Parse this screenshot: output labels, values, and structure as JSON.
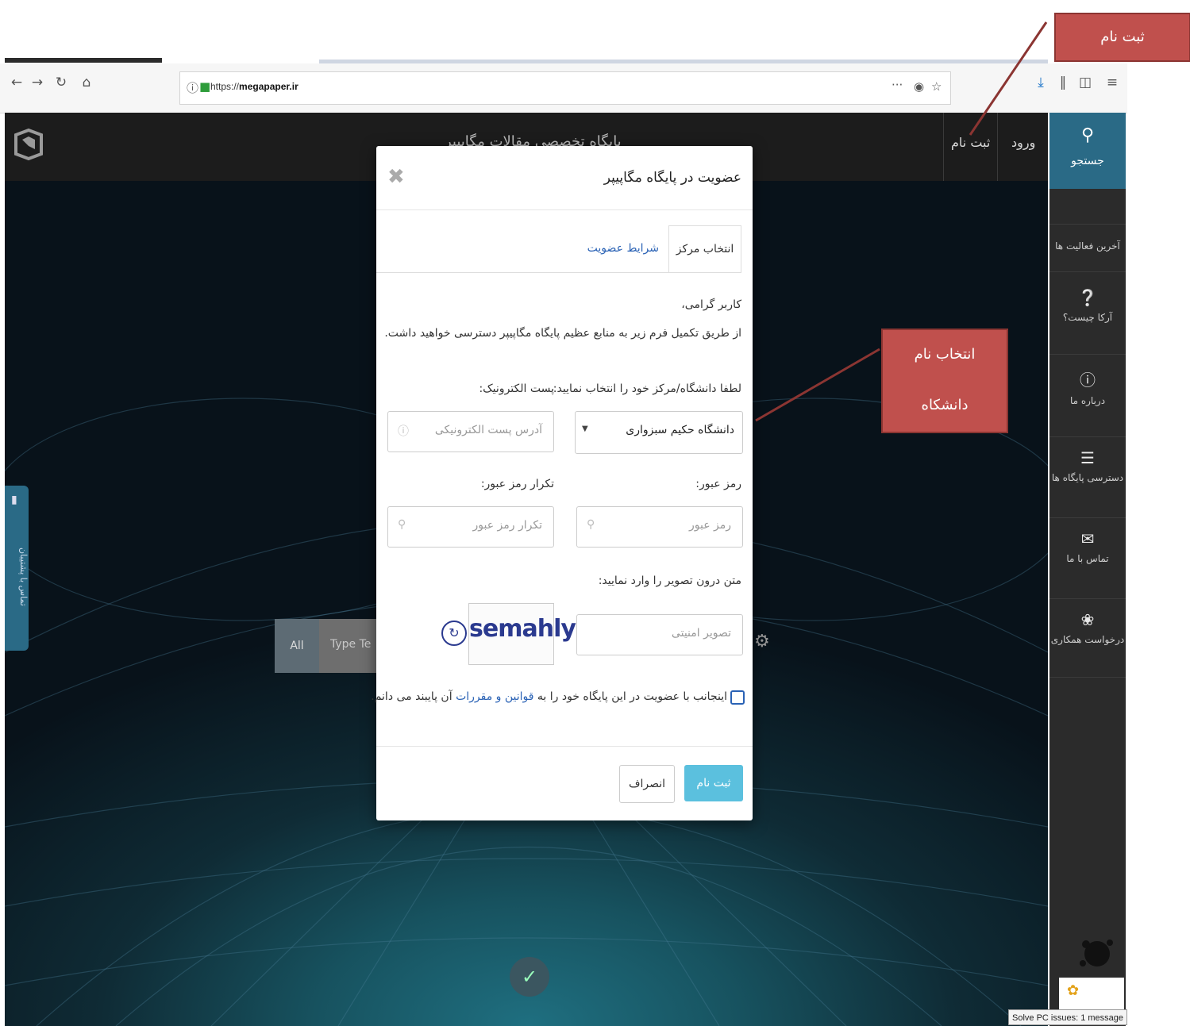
{
  "browser": {
    "url_prefix": "https://",
    "url_domain": "megapaper.ir",
    "url_actions": "···",
    "icons": [
      "back-icon",
      "forward-icon",
      "reload-icon",
      "home-icon",
      "info-icon",
      "lock-icon",
      "pocket-icon",
      "bookmark-star-icon",
      "download-icon",
      "library-icon",
      "sidebar-icon",
      "menu-icon"
    ]
  },
  "site": {
    "title": "پایگاه تخصصی مقالات مگاپیپر",
    "nav_login": "ورود",
    "nav_register": "ثبت نام"
  },
  "sidebar": {
    "search_label": "جستجو",
    "items": [
      {
        "label": "آخرین فعالیت ها",
        "icon": "none"
      },
      {
        "label": "آرکا چیست؟",
        "icon": "question-icon"
      },
      {
        "label": "درباره ما",
        "icon": "info-circle-icon"
      },
      {
        "label": "دسترسی پایگاه ها",
        "icon": "database-icon"
      },
      {
        "label": "تماس با ما",
        "icon": "envelope-icon"
      },
      {
        "label": "درخواست همکاری",
        "icon": "handshake-icon"
      }
    ]
  },
  "left_tab": {
    "label": "تماس با پشتیبان"
  },
  "bg_search": {
    "scope": "All",
    "placeholder": "Type Te"
  },
  "modal": {
    "title": "عضویت در پایگاه مگاپیپر",
    "tabs": {
      "center": "انتخاب مرکز",
      "terms": "شرایط عضویت"
    },
    "greeting": "کاربر گرامی،",
    "intro": "از طریق تکمیل فرم زیر به منابع عظیم پایگاه مگاپیپر دسترسی خواهید داشت.",
    "university": {
      "label": "لطفا دانشگاه/مرکز خود را انتخاب نمایید:",
      "value": "دانشگاه حکیم سبزواری"
    },
    "email": {
      "label": "پست الکترونیک:",
      "placeholder": "آدرس پست الکترونیکی"
    },
    "password": {
      "label": "رمز عبور:",
      "placeholder": "رمز عبور"
    },
    "password_repeat": {
      "label": "تکرار رمز عبور:",
      "placeholder": "تکرار رمز عبور"
    },
    "captcha": {
      "label": "متن درون تصویر را وارد نمایید:",
      "placeholder": "تصویر امنیتی",
      "image_text": "semahly"
    },
    "agreement": {
      "before": "اینجانب با عضویت در این پایگاه خود را به ",
      "link": "قوانین و مقررات",
      "after": " آن پایبند می دانم."
    },
    "buttons": {
      "register": "ثبت نام",
      "cancel": "انصراف"
    }
  },
  "annotations": {
    "register_callout": "ثبت نام",
    "university_callout_line1": "انتخاب نام",
    "university_callout_line2": "دانشکاه",
    "color": "#c0504d"
  },
  "ad": {
    "caption": "Solve PC issues: 1 message"
  }
}
